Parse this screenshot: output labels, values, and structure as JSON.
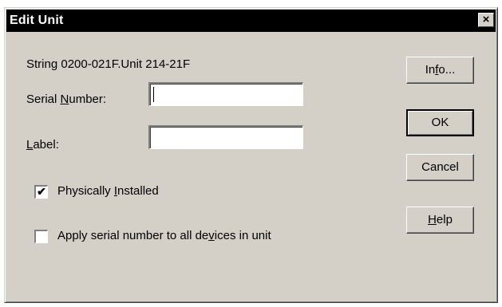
{
  "dialog": {
    "title": "Edit Unit",
    "close_glyph": "×"
  },
  "info_text": "String 0200-021F.Unit 214-21F",
  "serial": {
    "label_pre": "Serial ",
    "label_accel": "N",
    "label_post": "umber:",
    "value": ""
  },
  "label_field": {
    "label_pre": "",
    "label_accel": "L",
    "label_post": "abel:",
    "value": ""
  },
  "physically_installed": {
    "checked": true,
    "mark": "✔",
    "label_pre": "Physically ",
    "label_accel": "I",
    "label_post": "nstalled"
  },
  "apply_serial": {
    "checked": false,
    "label_pre": "Apply serial number to all de",
    "label_accel": "v",
    "label_post": "ices in unit"
  },
  "buttons": {
    "info": {
      "pre": "In",
      "accel": "f",
      "post": "o..."
    },
    "ok": {
      "label": "OK"
    },
    "cancel": {
      "label": "Cancel"
    },
    "help": {
      "pre": "",
      "accel": "H",
      "post": "elp"
    }
  }
}
